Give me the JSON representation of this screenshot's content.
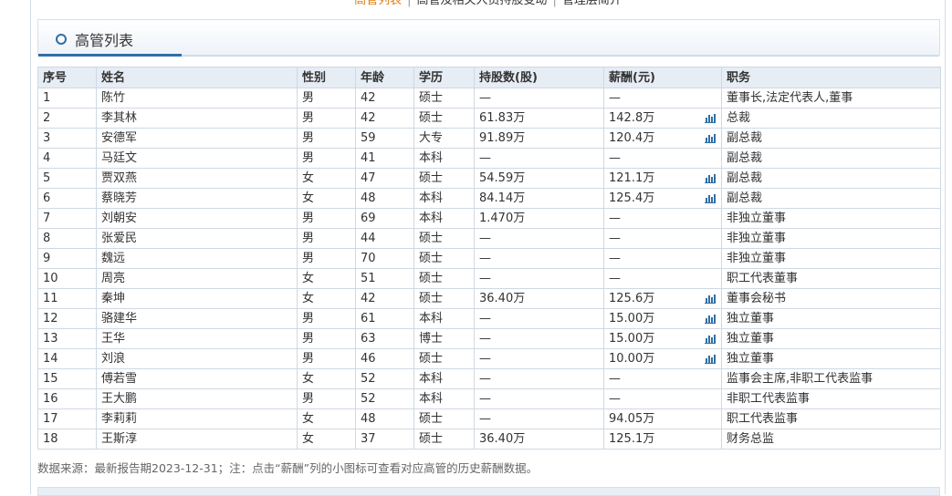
{
  "nav": {
    "items": [
      "高管列表",
      "高管及相关人员持股变动",
      "管理层简介"
    ],
    "separator": "|"
  },
  "section": {
    "title": "高管列表"
  },
  "table": {
    "columns": [
      "序号",
      "姓名",
      "性别",
      "年龄",
      "学历",
      "持股数(股)",
      "薪酬(元)",
      "职务"
    ],
    "rows": [
      {
        "no": "1",
        "name": "陈竹",
        "gender": "男",
        "age": "42",
        "edu": "硕士",
        "shares": "—",
        "salary": "—",
        "chart": false,
        "title": "董事长,法定代表人,董事"
      },
      {
        "no": "2",
        "name": "李其林",
        "gender": "男",
        "age": "42",
        "edu": "硕士",
        "shares": "61.83万",
        "salary": "142.8万",
        "chart": true,
        "title": "总裁"
      },
      {
        "no": "3",
        "name": "安德军",
        "gender": "男",
        "age": "59",
        "edu": "大专",
        "shares": "91.89万",
        "salary": "120.4万",
        "chart": true,
        "title": "副总裁"
      },
      {
        "no": "4",
        "name": "马廷文",
        "gender": "男",
        "age": "41",
        "edu": "本科",
        "shares": "—",
        "salary": "—",
        "chart": false,
        "title": "副总裁"
      },
      {
        "no": "5",
        "name": "贾双燕",
        "gender": "女",
        "age": "47",
        "edu": "硕士",
        "shares": "54.59万",
        "salary": "121.1万",
        "chart": true,
        "title": "副总裁"
      },
      {
        "no": "6",
        "name": "蔡晓芳",
        "gender": "女",
        "age": "48",
        "edu": "本科",
        "shares": "84.14万",
        "salary": "125.4万",
        "chart": true,
        "title": "副总裁"
      },
      {
        "no": "7",
        "name": "刘朝安",
        "gender": "男",
        "age": "69",
        "edu": "本科",
        "shares": "1.470万",
        "salary": "—",
        "chart": false,
        "title": "非独立董事"
      },
      {
        "no": "8",
        "name": "张爱民",
        "gender": "男",
        "age": "44",
        "edu": "硕士",
        "shares": "—",
        "salary": "—",
        "chart": false,
        "title": "非独立董事"
      },
      {
        "no": "9",
        "name": "魏远",
        "gender": "男",
        "age": "70",
        "edu": "硕士",
        "shares": "—",
        "salary": "—",
        "chart": false,
        "title": "非独立董事"
      },
      {
        "no": "10",
        "name": "周亮",
        "gender": "女",
        "age": "51",
        "edu": "硕士",
        "shares": "—",
        "salary": "—",
        "chart": false,
        "title": "职工代表董事"
      },
      {
        "no": "11",
        "name": "秦坤",
        "gender": "女",
        "age": "42",
        "edu": "硕士",
        "shares": "36.40万",
        "salary": "125.6万",
        "chart": true,
        "title": "董事会秘书"
      },
      {
        "no": "12",
        "name": "骆建华",
        "gender": "男",
        "age": "61",
        "edu": "本科",
        "shares": "—",
        "salary": "15.00万",
        "chart": true,
        "title": "独立董事"
      },
      {
        "no": "13",
        "name": "王华",
        "gender": "男",
        "age": "63",
        "edu": "博士",
        "shares": "—",
        "salary": "15.00万",
        "chart": true,
        "title": "独立董事"
      },
      {
        "no": "14",
        "name": "刘浪",
        "gender": "男",
        "age": "46",
        "edu": "硕士",
        "shares": "—",
        "salary": "10.00万",
        "chart": true,
        "title": "独立董事"
      },
      {
        "no": "15",
        "name": "傅若雪",
        "gender": "女",
        "age": "52",
        "edu": "本科",
        "shares": "—",
        "salary": "—",
        "chart": false,
        "title": "监事会主席,非职工代表监事"
      },
      {
        "no": "16",
        "name": "王大鹏",
        "gender": "男",
        "age": "52",
        "edu": "本科",
        "shares": "—",
        "salary": "—",
        "chart": false,
        "title": "非职工代表监事"
      },
      {
        "no": "17",
        "name": "李莉莉",
        "gender": "女",
        "age": "48",
        "edu": "硕士",
        "shares": "—",
        "salary": "94.05万",
        "chart": false,
        "title": "职工代表监事"
      },
      {
        "no": "18",
        "name": "王斯淳",
        "gender": "女",
        "age": "37",
        "edu": "硕士",
        "shares": "36.40万",
        "salary": "125.1万",
        "chart": false,
        "title": "财务总监"
      }
    ]
  },
  "footnote": "数据来源：最新报告期2023-12-31；注：点击“薪酬”列的小图标可查看对应高管的历史薪酬数据。",
  "colors": {
    "accent": "#2f6ea5",
    "active_nav": "#e07a10",
    "header_bg": "#e6edf5",
    "border": "#cfd9e3"
  }
}
